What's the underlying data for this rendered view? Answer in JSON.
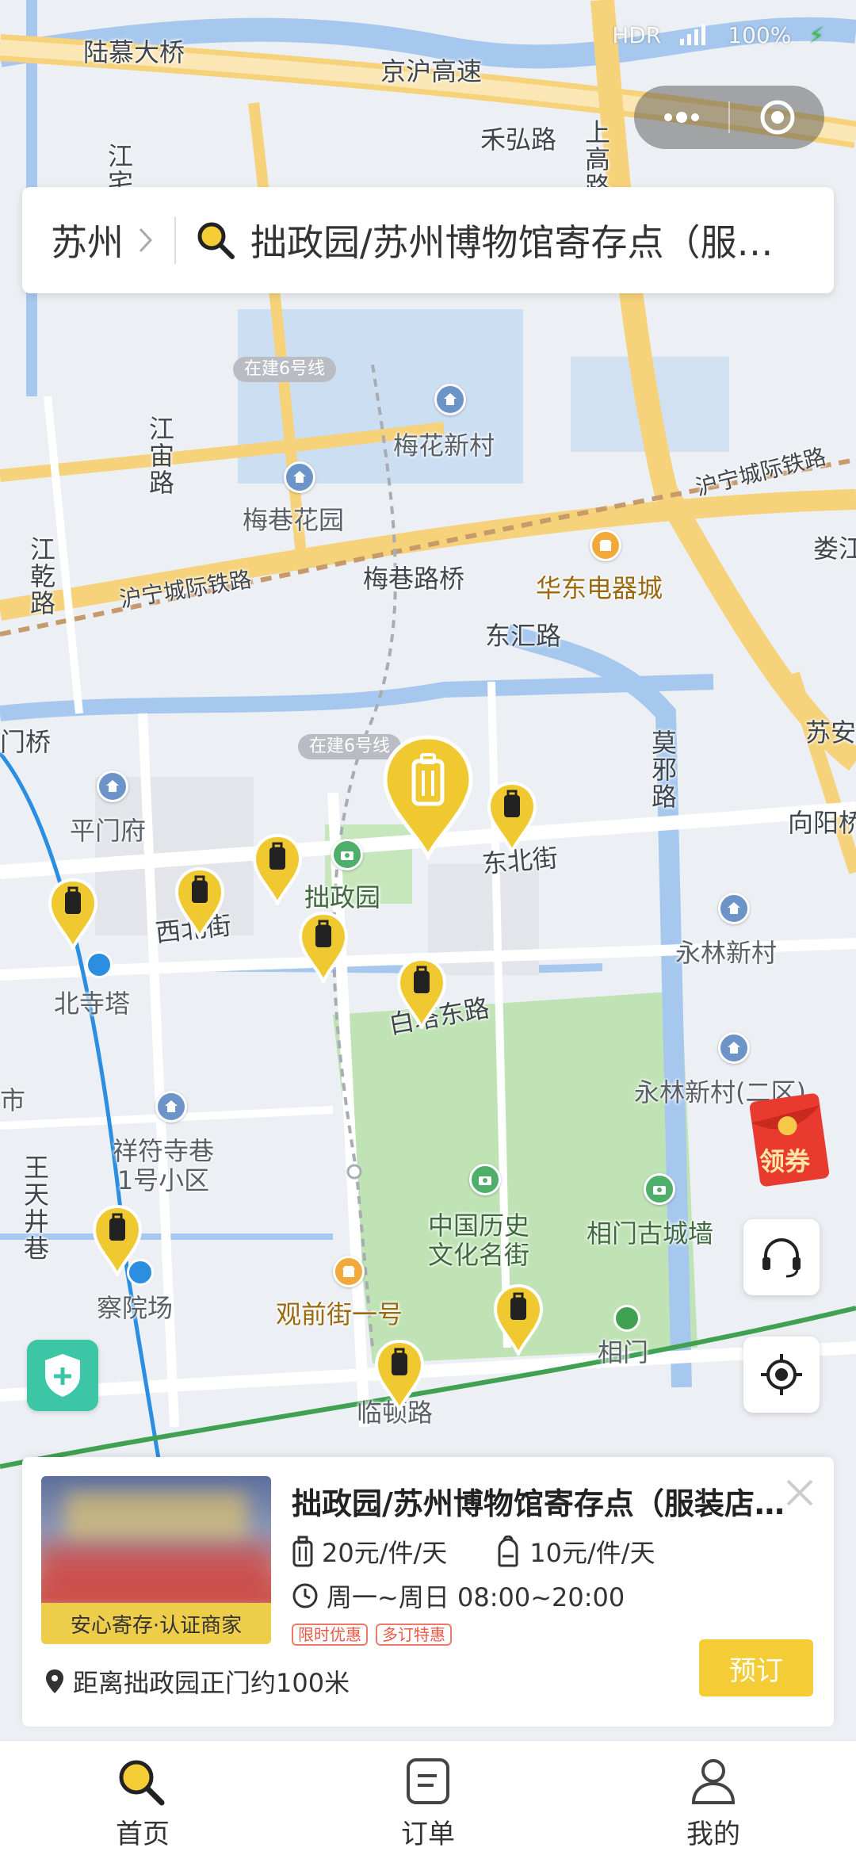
{
  "status_bar": {
    "hdr": "HDR",
    "battery": "100%"
  },
  "search": {
    "city": "苏州",
    "query": "拙政园/苏州博物馆寄存点（服装店内）"
  },
  "map": {
    "labels": {
      "lumu_bridge": "陆慕大桥",
      "jinghu_expressway": "京沪高速",
      "hehong_road": "禾弘路",
      "shanggao_road": "上高路",
      "jiangzhan": "江宅",
      "line6_a": "在建6号线",
      "line6_b": "在建6号线",
      "meihua": "梅花新村",
      "jiangmiao_road": "江宙路",
      "huning_rail_1": "沪宁城际铁路",
      "huning_rail_2": "沪宁城际铁路",
      "meixiang_garden": "梅巷花园",
      "lou": "娄江",
      "jianggan_road": "江乾路",
      "meixiang_bridge": "梅巷路桥",
      "huadong_mall": "华东电器城",
      "donghui_road": "东汇路",
      "men_bridge": "门桥",
      "moxie_road": "莫邪路",
      "suan": "苏安",
      "xiangyang": "向阳桥",
      "pingmen": "平门府",
      "dongbei_street": "东北街",
      "zhuozheng": "拙政园",
      "xibei_street": "西北街",
      "yonglin": "永林新村",
      "beisita": "北寺塔",
      "baita_road": "白塔东路",
      "yonglin2": "永林新村(二区)",
      "xiangfu": "祥符寺巷\n1号小区",
      "wangtian": "王天井巷",
      "lishi_street": "中国历史\n文化名街",
      "xiangmen_old": "相门古城墙",
      "chayuan": "察院场",
      "guanqian": "观前街一号",
      "xiangmen": "相门",
      "lindun": "临顿路",
      "shi": "市"
    }
  },
  "coupon_label": "领券",
  "card": {
    "title": "拙政园/苏州博物馆寄存点（服装店内）",
    "badge": "安心寄存·认证商家",
    "price_luggage": "20元/件/天",
    "price_bag": "10元/件/天",
    "hours": "周一~周日 08:00~20:00",
    "tags": [
      "限时优惠",
      "多订特惠"
    ],
    "distance": "距离拙政园正门约100米",
    "book_label": "预订"
  },
  "tabs": [
    {
      "label": "首页",
      "icon": "search-icon"
    },
    {
      "label": "订单",
      "icon": "order-icon"
    },
    {
      "label": "我的",
      "icon": "user-icon"
    }
  ],
  "colors": {
    "accent": "#f3cc36",
    "pin": "#f0c930",
    "road": "#f6d27a",
    "water": "#a7c8ee",
    "park": "#bfe3b4"
  }
}
